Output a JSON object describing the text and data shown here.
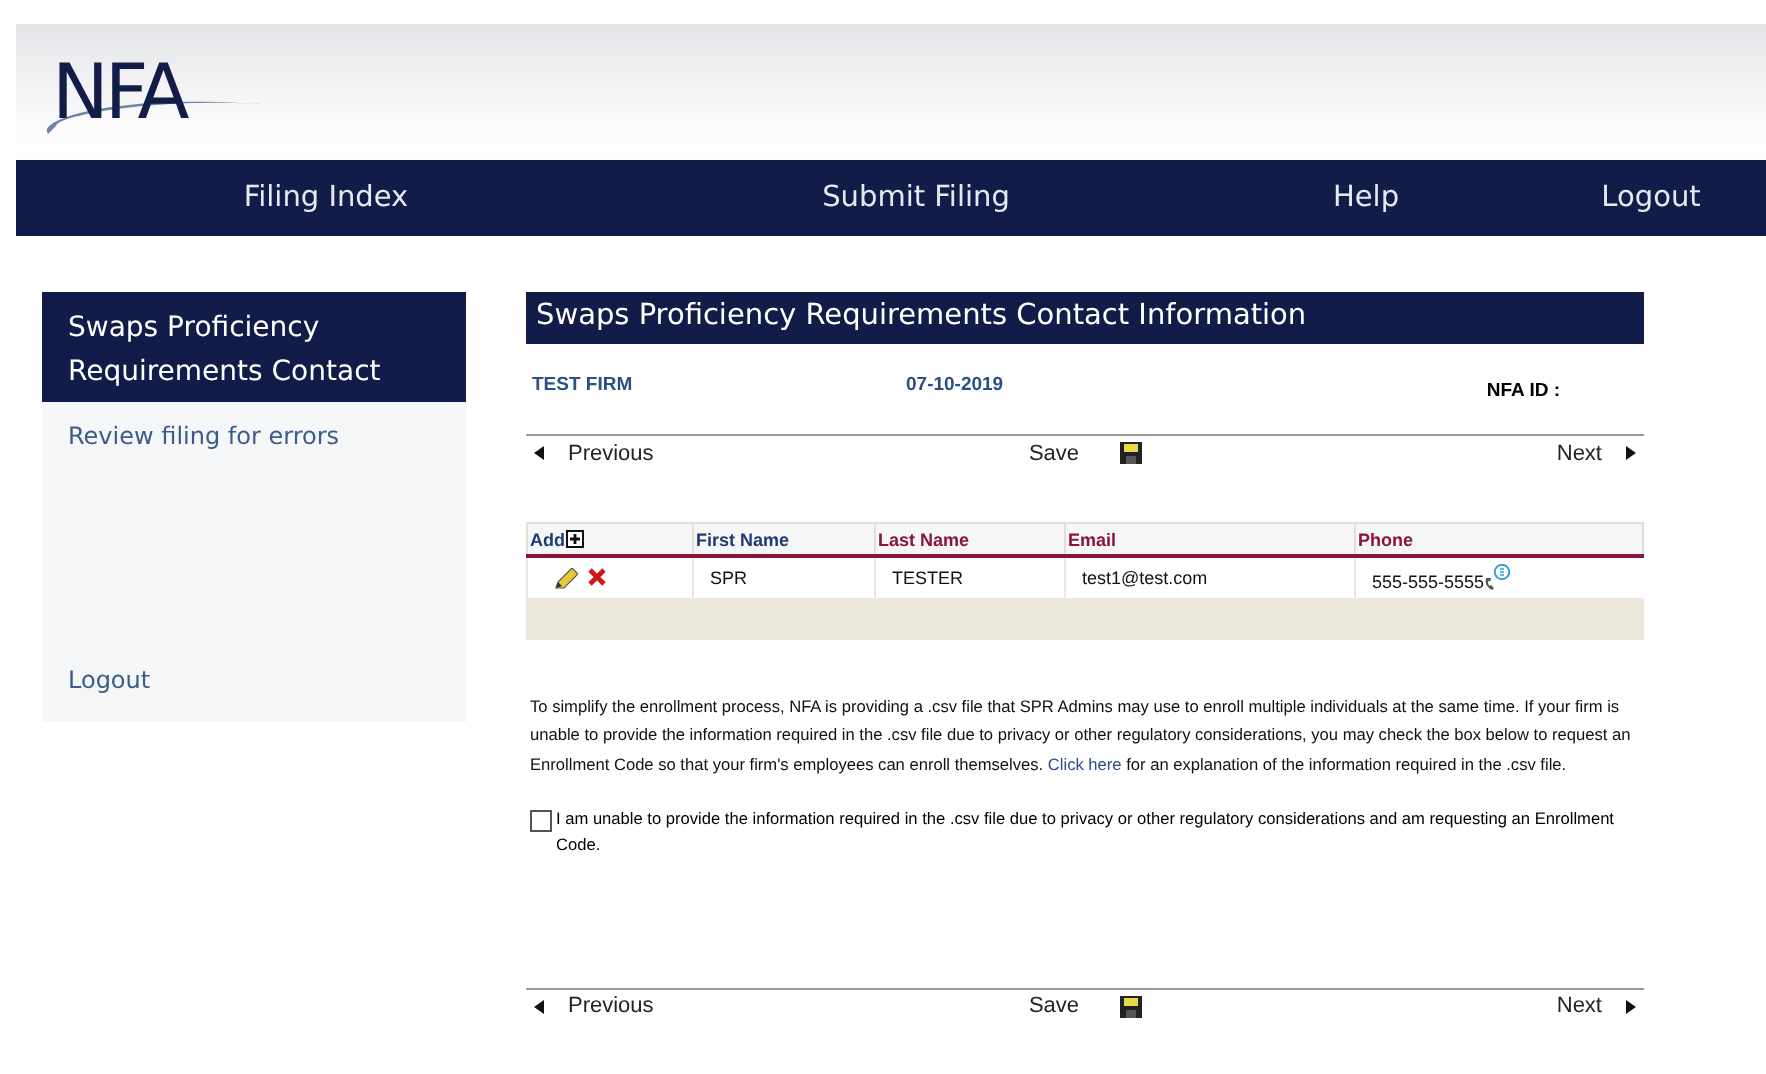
{
  "logo": {
    "text": "NFA"
  },
  "menu": [
    {
      "label": "Filing Index"
    },
    {
      "label": "Submit Filing"
    },
    {
      "label": "Help"
    },
    {
      "label": "Logout"
    }
  ],
  "sidebar": {
    "title": "Swaps Proficiency Requirements Contact",
    "links": [
      {
        "label": "Review filing for errors"
      },
      {
        "label": "Logout"
      }
    ]
  },
  "page_title": "Swaps Proficiency Requirements Contact Information",
  "firm": {
    "name": "TEST FIRM",
    "date": "07-10-2019",
    "nfa_id_label": "NFA ID :"
  },
  "nav_bars": [
    {
      "previous": "Previous",
      "save": "Save",
      "next": "Next"
    },
    {
      "previous": "Previous",
      "save": "Save",
      "next": "Next"
    }
  ],
  "table": {
    "columns": [
      {
        "label": "Add",
        "color": "#1f3b73"
      },
      {
        "label": "First Name",
        "color": "#1f3b73"
      },
      {
        "label": "Last Name",
        "color": "#8a1538"
      },
      {
        "label": "Email",
        "color": "#8a1538"
      },
      {
        "label": "Phone",
        "color": "#8a1538"
      }
    ],
    "rows": [
      {
        "first_name": "SPR",
        "last_name": "TESTER",
        "email": "test1@test.com",
        "phone": "555-555-5555"
      }
    ]
  },
  "intro": {
    "before": "To simplify the enrollment process, NFA is providing a .csv file that SPR Admins may use to enroll multiple individuals at the same time. If your firm is unable to provide the information required in the .csv file due to privacy or other regulatory considerations, you may check the box below to request an Enrollment Code so that your firm's employees can enroll themselves.",
    "link": "Click here",
    "after": "for an explanation of the information required in the .csv file."
  },
  "consent": {
    "label": "I am unable to provide the information required in the .csv file due to privacy or other regulatory considerations and am requesting an Enrollment Code.",
    "checked": false
  }
}
